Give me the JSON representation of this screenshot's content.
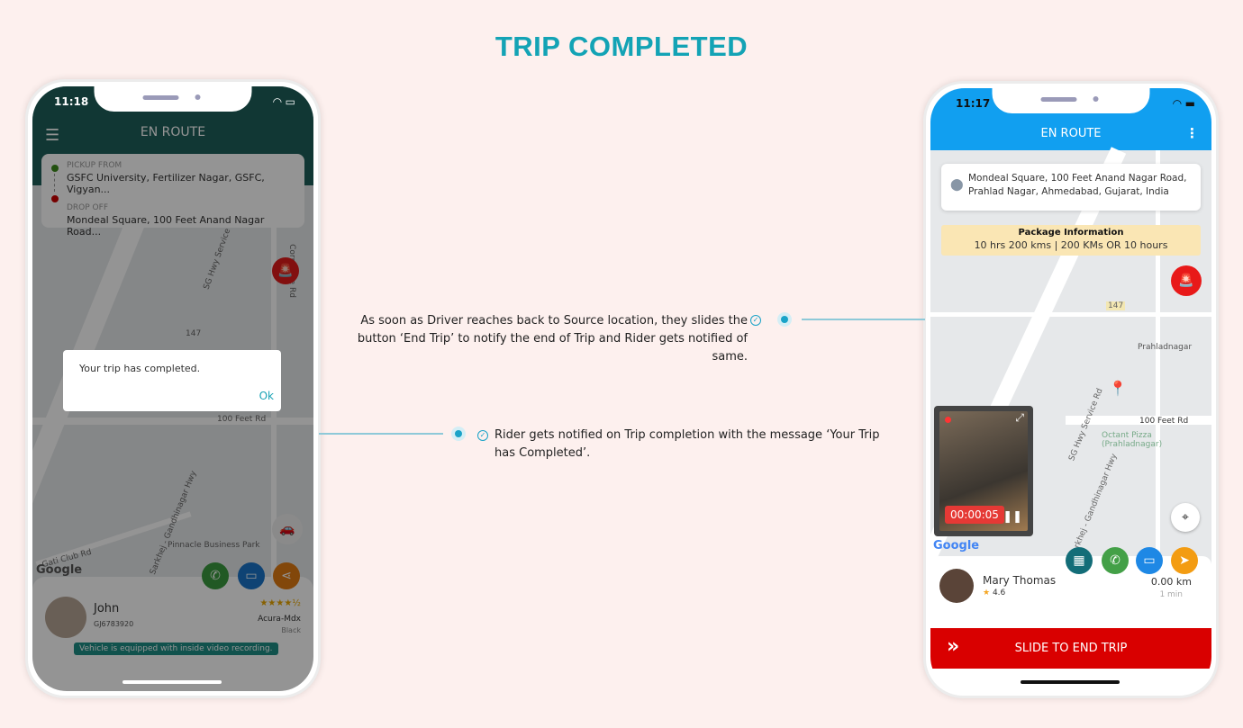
{
  "title": "TRIP COMPLETED",
  "rider_app": {
    "time": "11:18",
    "header": "EN ROUTE",
    "pickup_label": "PICKUP FROM",
    "pickup": "GSFC University, Fertilizer Nagar, GSFC, Vigyan...",
    "drop_label": "DROP OFF",
    "drop": "Mondeal Square, 100 Feet Anand Nagar Road...",
    "map_labels": [
      "SG Hwy Service Rd",
      "147",
      "100 Feet Rd",
      "Sarkhej - Gandhinagar Hwy",
      "Corporate Rd",
      "Pinnacle Business Park",
      "Gati Club Rd",
      "Google"
    ],
    "dialog": {
      "message": "Your trip has completed.",
      "ok": "Ok"
    },
    "driver": {
      "name": "John",
      "id": "GJ6783920",
      "rating": 4.5,
      "car": "Acura-Mdx",
      "color": "Black"
    },
    "video_notice": "Vehicle is equipped with inside video recording.",
    "colors": {
      "header": "#1e5f5a",
      "call": "#3a9a3e",
      "chat": "#1a74c8",
      "share": "#e07b12"
    }
  },
  "driver_app": {
    "time": "11:17",
    "header": "EN ROUTE",
    "address": "Mondeal Square, 100 Feet Anand Nagar Road, Prahlad Nagar, Ahmedabad, Gujarat, India",
    "package_title": "Package Information",
    "package_detail": "10 hrs 200 kms  | 200 KMs OR 10 hours",
    "map_labels": [
      "SG Hwy Service Rd",
      "147",
      "100 Feet Rd",
      "Prahladnagar",
      "Octant Pizza (Prahladnagar)",
      "Sarkhej - Gandhinagar Hwy",
      "Google"
    ],
    "video_timer": "00:00:05",
    "rider": {
      "name": "Mary Thomas",
      "rating": "4.6"
    },
    "distance": "0.00 km",
    "eta": "1 min",
    "slide_label": "SLIDE TO END TRIP",
    "colors": {
      "header": "#119ff0",
      "slide": "#d90000",
      "sos": "#e81919"
    }
  },
  "notes": {
    "driver_note": "As soon as Driver reaches back to Source location, they slides the button ‘End Trip’ to notify the end of Trip and Rider gets notified of same.",
    "rider_note": "Rider gets notified on Trip completion with the message ‘Your Trip has Completed’."
  }
}
